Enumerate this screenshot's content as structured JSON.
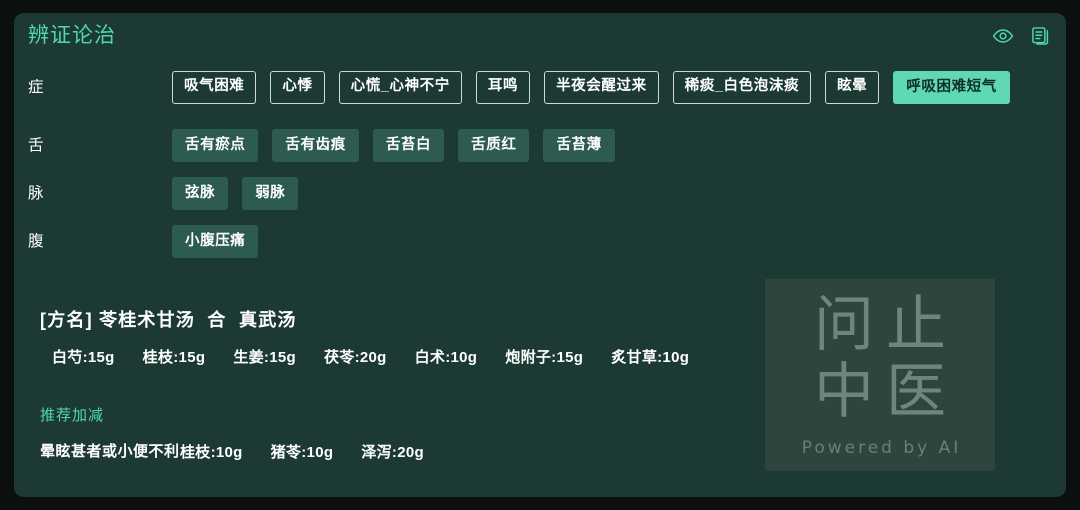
{
  "header": {
    "title": "辨证论治",
    "icons": [
      {
        "name": "eye-icon",
        "label": "查看"
      },
      {
        "name": "document-copy-icon",
        "label": "病历"
      }
    ]
  },
  "colors": {
    "page_background": "#0b0f0d",
    "card_background": "#1c3a33",
    "accent": "#4fd8ae",
    "highlight_tag": "#5fd9b4",
    "fill_tag": "#2d5b50",
    "outline_tag_border": "#cfd8d5",
    "text": "#ffffff"
  },
  "rows": [
    {
      "label": "症",
      "tags": [
        {
          "text": "吸气困难",
          "style": "outline"
        },
        {
          "text": "心悸",
          "style": "outline"
        },
        {
          "text": "心慌_心神不宁",
          "style": "outline"
        },
        {
          "text": "耳鸣",
          "style": "outline"
        },
        {
          "text": "半夜会醒过来",
          "style": "outline"
        },
        {
          "text": "稀痰_白色泡沫痰",
          "style": "outline"
        },
        {
          "text": "眩晕",
          "style": "outline"
        },
        {
          "text": "呼吸困难短气",
          "style": "accent"
        }
      ]
    },
    {
      "label": "舌",
      "tags": [
        {
          "text": "舌有瘀点",
          "style": "fill"
        },
        {
          "text": "舌有齿痕",
          "style": "fill"
        },
        {
          "text": "舌苔白",
          "style": "fill"
        },
        {
          "text": "舌质红",
          "style": "fill"
        },
        {
          "text": "舌苔薄",
          "style": "fill"
        }
      ]
    },
    {
      "label": "脉",
      "tags": [
        {
          "text": "弦脉",
          "style": "fill"
        },
        {
          "text": "弱脉",
          "style": "fill"
        }
      ]
    },
    {
      "label": "腹",
      "tags": [
        {
          "text": "小腹压痛",
          "style": "fill"
        }
      ]
    }
  ],
  "formula": {
    "name": "[方名] 苓桂术甘汤  合  真武汤",
    "herbs": [
      "白芍:15g",
      "桂枝:15g",
      "生姜:15g",
      "茯苓:20g",
      "白术:10g",
      "炮附子:15g",
      "炙甘草:10g"
    ]
  },
  "recommend": {
    "title": "推荐加减",
    "condition": "晕眩甚者或小便不利",
    "herbs": [
      "桂枝:10g",
      "猪苓:10g",
      "泽泻:20g"
    ]
  },
  "watermark": {
    "line1": "问止",
    "line2": "中医",
    "subtitle": "Powered by AI"
  }
}
